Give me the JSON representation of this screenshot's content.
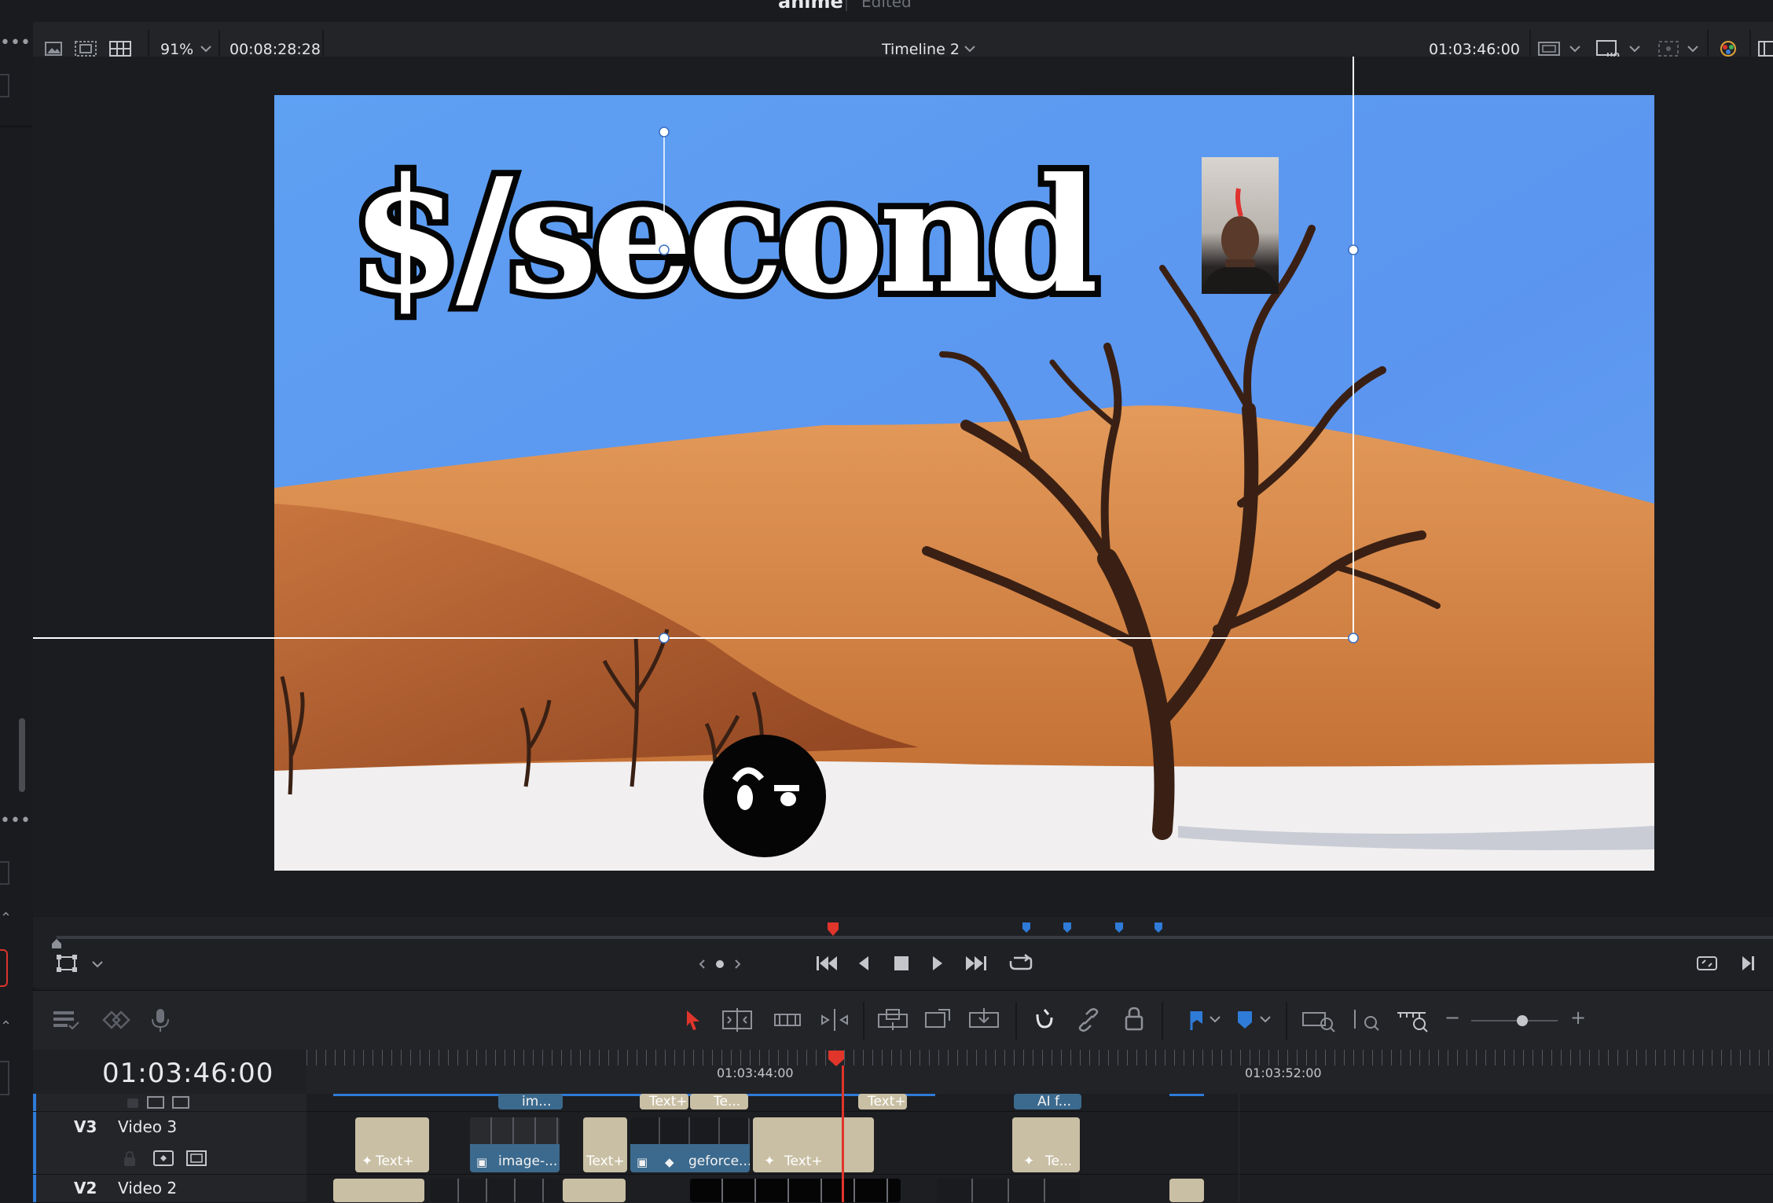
{
  "window": {
    "project_title": "anime",
    "project_status": "Edited"
  },
  "viewer_toolbar": {
    "zoom": "91%",
    "source_duration": "00:08:28:28",
    "timeline_name": "Timeline 2",
    "record_timecode": "01:03:46:00"
  },
  "overlay": {
    "title_text": "$/second"
  },
  "timeline": {
    "current_timecode": "01:03:46:00",
    "ruler_labels": [
      "01:03:44:00",
      "01:03:52:00"
    ],
    "tracks": [
      {
        "id": "V3",
        "name": "Video 3"
      },
      {
        "id": "V2",
        "name": "Video 2"
      }
    ],
    "clips": {
      "text_plus": "Text+",
      "image": "image-...",
      "geforce": "geforce...",
      "te": "Te...",
      "partial_top_1": "im...",
      "partial_top_2": "Te...",
      "partial_top_3": "Text+",
      "partial_top_4": "AI f..."
    }
  },
  "colors": {
    "accent_blue": "#2f7bd8",
    "playhead_red": "#e0352b",
    "text_clip": "#c9bfa4",
    "media_clip": "#3c6a8e"
  }
}
